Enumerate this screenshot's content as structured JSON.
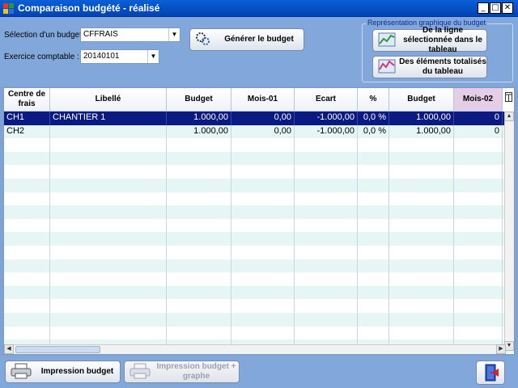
{
  "window": {
    "title": "Comparaison budgété - réalisé",
    "min": "_",
    "max": "□",
    "close": "✕"
  },
  "form": {
    "budget_label": "Sélection d'un budget:",
    "budget_value": "CFFRAIS",
    "exercise_label": "Exercice comptable :",
    "exercise_value": "20140101",
    "generate_label": "Générer le budget"
  },
  "graph": {
    "legend": "Représentation graphique du budget",
    "line_label": "De la ligne sélectionnée dans le tableau",
    "totals_label": "Des éléments totalisés du tableau"
  },
  "table": {
    "columns": [
      "Centre de frais",
      "Libellé",
      "Budget",
      "Mois-01",
      "Ecart",
      "%",
      "Budget",
      "Mois-02"
    ],
    "rows": [
      [
        "CH1",
        "CHANTIER 1",
        "1.000,00",
        "0,00",
        "-1.000,00",
        "0,0 %",
        "1.000,00",
        "0"
      ],
      [
        "CH2",
        "",
        "1.000,00",
        "0,00",
        "-1.000,00",
        "0,0 %",
        "1.000,00",
        "0"
      ]
    ]
  },
  "bottom": {
    "print_label": "Impression budget",
    "print_graph_label": "Impression budget + graphe"
  }
}
